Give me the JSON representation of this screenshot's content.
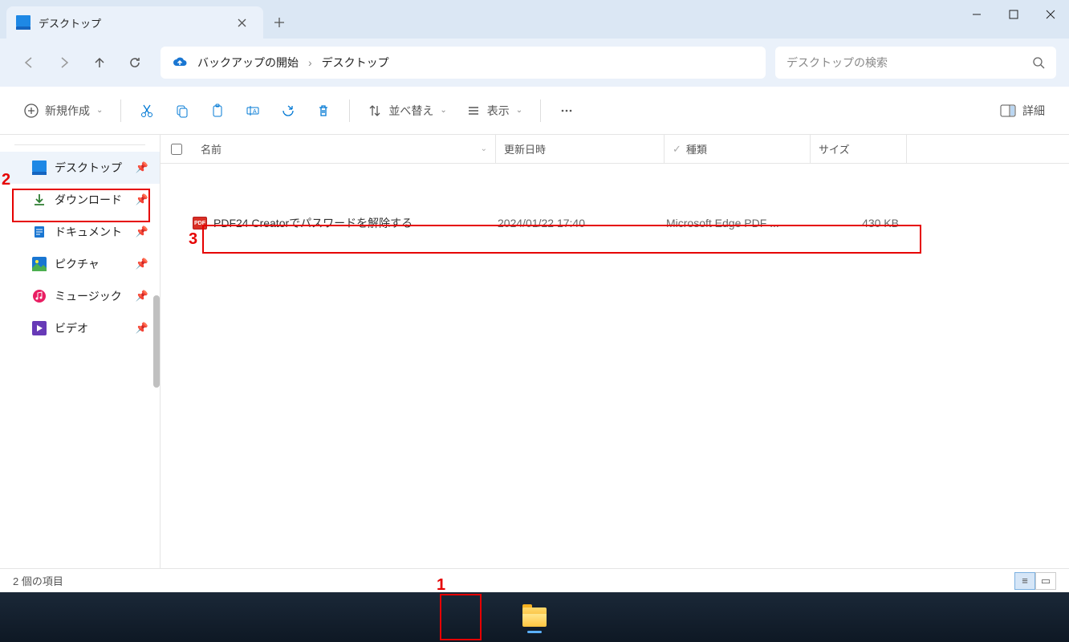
{
  "tab": {
    "title": "デスクトップ"
  },
  "breadcrumb": {
    "backup": "バックアップの開始",
    "location": "デスクトップ"
  },
  "search": {
    "placeholder": "デスクトップの検索"
  },
  "toolbar": {
    "new": "新規作成",
    "sort": "並べ替え",
    "view": "表示",
    "details": "詳細"
  },
  "sidebar": {
    "items": [
      {
        "label": "デスクトップ"
      },
      {
        "label": "ダウンロード"
      },
      {
        "label": "ドキュメント"
      },
      {
        "label": "ピクチャ"
      },
      {
        "label": "ミュージック"
      },
      {
        "label": "ビデオ"
      }
    ]
  },
  "columns": {
    "name": "名前",
    "date": "更新日時",
    "type": "種類",
    "size": "サイズ"
  },
  "files": [
    {
      "name": "PDF24 Creatorでパスワードを解除する",
      "date": "2024/01/22 17:40",
      "type": "Microsoft Edge PDF ...",
      "size": "430 KB"
    }
  ],
  "status": {
    "count": "2 個の項目"
  },
  "annotations": {
    "a1": "1",
    "a2": "2",
    "a3": "3"
  }
}
